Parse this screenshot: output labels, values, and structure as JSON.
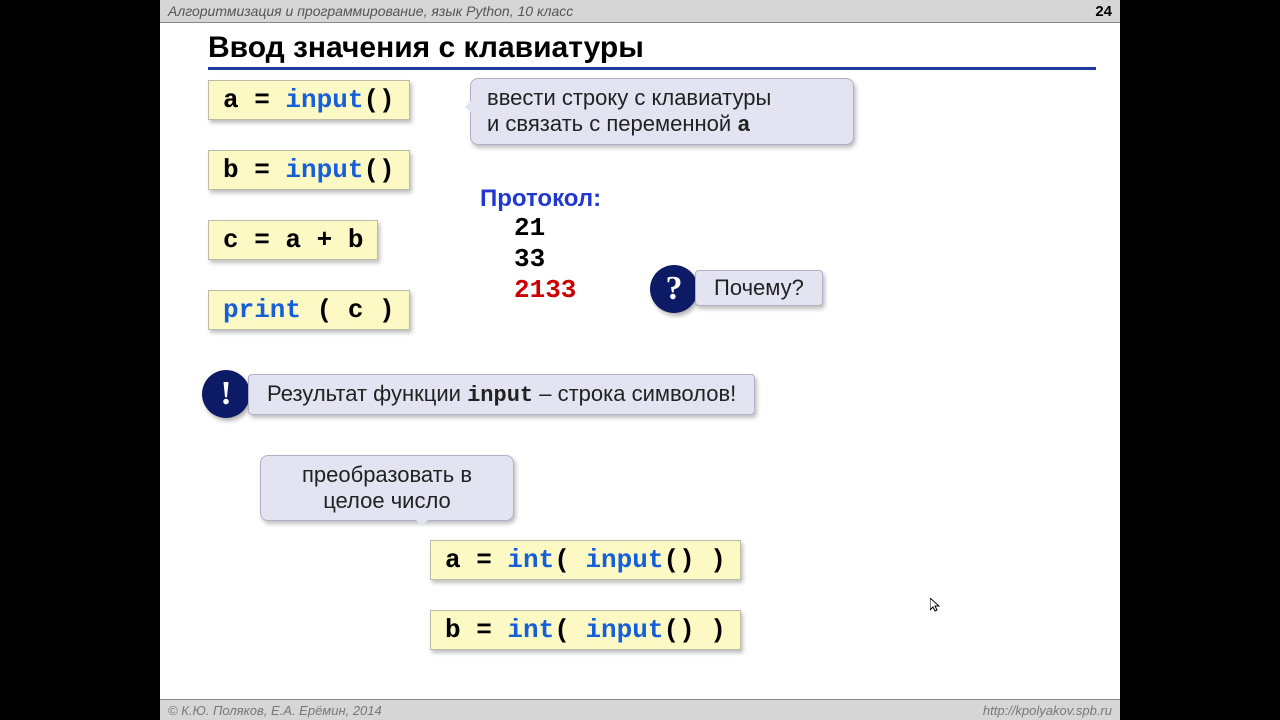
{
  "header": {
    "subject": "Алгоритмизация и программирование, язык Python, 10 класс",
    "page": "24"
  },
  "title": "Ввод значения с клавиатуры",
  "code": {
    "l1a": "a",
    "l1eq": " = ",
    "l1fn": "input",
    "l1p": "()",
    "l2a": "b",
    "l2eq": " = ",
    "l2fn": "input",
    "l2p": "()",
    "l3": "c = a + b",
    "l4fn": "print",
    "l4rest": " ( c )"
  },
  "bubble1_line1": "ввести строку с клавиатуры",
  "bubble1_line2a": "и связать с переменной ",
  "bubble1_line2b": "a",
  "protocol_label": "Протокол:",
  "protocol": {
    "v1": "21",
    "v2": "33",
    "v3": "2133"
  },
  "why_mark": "?",
  "why_text": "Почему?",
  "excl_mark": "!",
  "result_a": "Результат функции ",
  "result_b": "input",
  "result_c": " – строка символов!",
  "convert_l1": "преобразовать в",
  "convert_l2": "целое число",
  "codeint": {
    "a1": "a",
    "eq": " = ",
    "intfn": "int",
    "lp": "( ",
    "inp": "input",
    "pp": "()",
    "rp": " )",
    "b1": "b"
  },
  "footer": {
    "copyright": "© К.Ю. Поляков, Е.А. Ерёмин, 2014",
    "url": "http://kpolyakov.spb.ru"
  }
}
